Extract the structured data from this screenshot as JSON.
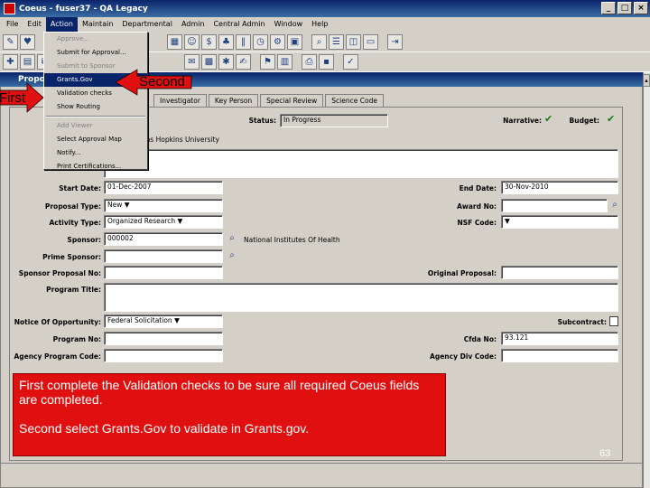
{
  "window": {
    "title": "Coeus - fuser37 - QA Legacy",
    "controls": [
      "_",
      "□",
      "×"
    ]
  },
  "menu": [
    "File",
    "Edit",
    "Action",
    "Maintain",
    "Departmental",
    "Admin",
    "Central Admin",
    "Window",
    "Help"
  ],
  "action_menu": {
    "items": [
      {
        "label": "Approve...",
        "disabled": true
      },
      {
        "label": "Submit for Approval...",
        "disabled": false
      },
      {
        "label": "Submit to Sponsor",
        "disabled": true
      },
      {
        "label": "Grants.Gov",
        "disabled": false,
        "highlighted": true
      },
      {
        "label": "Validation checks",
        "disabled": false
      },
      {
        "label": "Show Routing",
        "disabled": false
      },
      {
        "label": "Add Viewer",
        "disabled": true
      },
      {
        "label": "Select Approval Map",
        "disabled": false
      },
      {
        "label": "Notify...",
        "disabled": false
      },
      {
        "label": "Print Certifications...",
        "disabled": false
      }
    ]
  },
  "mdi_title": "Proposal",
  "tabs": [
    "Investigator",
    "Key Person",
    "Special Review",
    "Science Code"
  ],
  "form": {
    "status_label": "Status:",
    "status_value": "In Progress",
    "narrative_label": "Narrative:",
    "budget_label": "Budget:",
    "org_value": "Johns Hopkins University",
    "start_date_label": "Start Date:",
    "start_date_value": "01-Dec-2007",
    "end_date_label": "End Date:",
    "end_date_value": "30-Nov-2010",
    "proposal_type_label": "Proposal Type:",
    "proposal_type_value": "New",
    "award_no_label": "Award No:",
    "activity_type_label": "Activity Type:",
    "activity_type_value": "Organized Research",
    "nsf_code_label": "NSF Code:",
    "sponsor_label": "Sponsor:",
    "sponsor_value": "000002",
    "sponsor_name": "National Institutes Of Health",
    "prime_sponsor_label": "Prime Sponsor:",
    "sponsor_proposal_label": "Sponsor Proposal No:",
    "original_proposal_label": "Original Proposal:",
    "program_title_label": "Program Title:",
    "notice_label": "Notice Of Opportunity:",
    "notice_value": "Federal Solicitation",
    "subcontract_label": "Subcontract:",
    "program_no_label": "Program No:",
    "cfda_label": "Cfda No:",
    "cfda_value": "93.121",
    "agency_prog_label": "Agency Program Code:",
    "agency_div_label": "Agency Div Code:"
  },
  "annotations": {
    "first": "First",
    "second": "Second",
    "callout_line1": "First complete the Validation checks to be sure all required Coeus fields are completed.",
    "callout_line2": "Second select Grants.Gov to validate in Grants.gov.",
    "page_number": "63",
    "arrow_color": "#e01010"
  }
}
